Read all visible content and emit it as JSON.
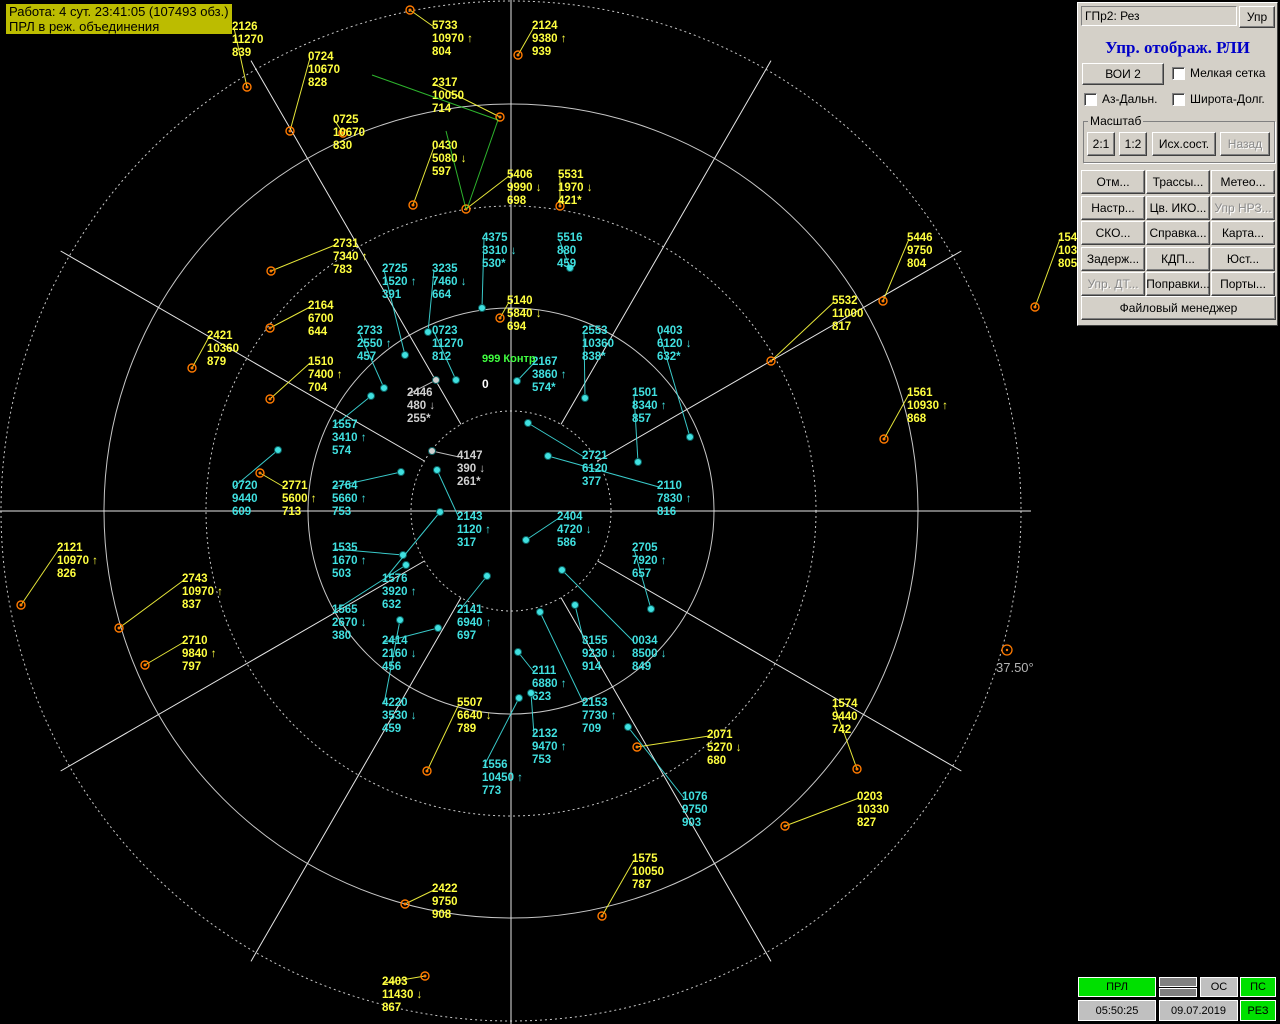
{
  "status": {
    "line1": "Работа: 4 сут. 23:41:05 (107493 обз.)",
    "line2": "ПРЛ в реж. объединения"
  },
  "radar": {
    "bearing_label": "37.50°",
    "center_marker": "0",
    "control_label": "999 Контр",
    "colors": {
      "ring": "#c8c8c8",
      "axis": "#e6e6e6",
      "yellow": "#ffff40",
      "cyan": "#40e0e0",
      "gray": "#d0d0d0",
      "green": "#40ff40",
      "marker": "#ff7a00"
    }
  },
  "tracks": [
    {
      "color": "yellow",
      "lines": [
        "2126",
        "11270",
        "839"
      ]
    },
    {
      "color": "yellow",
      "lines": [
        "0724",
        "10670",
        "828"
      ]
    },
    {
      "color": "yellow",
      "lines": [
        "0725",
        "10670",
        "830"
      ]
    },
    {
      "color": "yellow",
      "lines": [
        "5733",
        "10970 ↑",
        "804"
      ]
    },
    {
      "color": "yellow",
      "lines": [
        "2124",
        "9380 ↑",
        "939"
      ]
    },
    {
      "color": "yellow",
      "lines": [
        "2317",
        "10050",
        "714"
      ]
    },
    {
      "color": "yellow",
      "lines": [
        "0430",
        "5080 ↓",
        "597"
      ]
    },
    {
      "color": "yellow",
      "lines": [
        "5406",
        "9990 ↓",
        "698"
      ]
    },
    {
      "color": "yellow",
      "lines": [
        "5531",
        "1970 ↓",
        "421*"
      ]
    },
    {
      "color": "yellow",
      "lines": [
        "2731",
        "7340 ↑",
        "783"
      ]
    },
    {
      "color": "yellow",
      "lines": [
        "2164",
        "6700",
        "644"
      ]
    },
    {
      "color": "yellow",
      "lines": [
        "2421",
        "10360",
        "879"
      ]
    },
    {
      "color": "yellow",
      "lines": [
        "1510",
        "7400 ↑",
        "704"
      ]
    },
    {
      "color": "yellow",
      "lines": [
        "5140",
        "5840 ↓",
        "694"
      ]
    },
    {
      "color": "yellow",
      "lines": [
        "5446",
        "9750",
        "804"
      ]
    },
    {
      "color": "yellow",
      "lines": [
        "154",
        "103",
        "805"
      ]
    },
    {
      "color": "yellow",
      "lines": [
        "5532",
        "11000",
        "817"
      ]
    },
    {
      "color": "yellow",
      "lines": [
        "1561",
        "10930 ↑",
        "868"
      ]
    },
    {
      "color": "yellow",
      "lines": [
        "2771",
        "5600 ↑",
        "713"
      ]
    },
    {
      "color": "yellow",
      "lines": [
        "2121",
        "10970 ↑",
        "826"
      ]
    },
    {
      "color": "yellow",
      "lines": [
        "2743",
        "10970 ↑",
        "837"
      ]
    },
    {
      "color": "yellow",
      "lines": [
        "2710",
        "9840 ↑",
        "797"
      ]
    },
    {
      "color": "yellow",
      "lines": [
        "5507",
        "6640 ↓",
        "789"
      ]
    },
    {
      "color": "yellow",
      "lines": [
        "2071",
        "5270 ↓",
        "680"
      ]
    },
    {
      "color": "yellow",
      "lines": [
        "1574",
        "9440",
        "742"
      ]
    },
    {
      "color": "yellow",
      "lines": [
        "0203",
        "10330",
        "827"
      ]
    },
    {
      "color": "yellow",
      "lines": [
        "1575",
        "10050",
        "787"
      ]
    },
    {
      "color": "yellow",
      "lines": [
        "2422",
        "9750",
        "908"
      ]
    },
    {
      "color": "yellow",
      "lines": [
        "2403",
        "11430 ↓",
        "867"
      ]
    },
    {
      "color": "cyan",
      "lines": [
        "4375",
        "3310 ↓",
        "530*"
      ]
    },
    {
      "color": "cyan",
      "lines": [
        "5516",
        "880",
        "459"
      ]
    },
    {
      "color": "cyan",
      "lines": [
        "2725",
        "1520 ↑",
        "391"
      ]
    },
    {
      "color": "cyan",
      "lines": [
        "3235",
        "7460 ↓",
        "664"
      ]
    },
    {
      "color": "cyan",
      "lines": [
        "2733",
        "2550 ↑",
        "457"
      ]
    },
    {
      "color": "cyan",
      "lines": [
        "0723",
        "11270",
        "812"
      ]
    },
    {
      "color": "cyan",
      "lines": [
        "2553",
        "10360",
        "838*"
      ]
    },
    {
      "color": "cyan",
      "lines": [
        "0403",
        "6120 ↓",
        "632*"
      ]
    },
    {
      "color": "cyan",
      "lines": [
        "2167",
        "3860 ↑",
        "574*"
      ]
    },
    {
      "color": "cyan",
      "lines": [
        "1501",
        "8340 ↑",
        "857"
      ]
    },
    {
      "color": "cyan",
      "lines": [
        "1557",
        "3410 ↑",
        "574"
      ]
    },
    {
      "color": "cyan",
      "lines": [
        "2721",
        "6120",
        "377"
      ]
    },
    {
      "color": "cyan",
      "lines": [
        "2110",
        "7830 ↑",
        "816"
      ]
    },
    {
      "color": "cyan",
      "lines": [
        "0720",
        "9440",
        "609"
      ]
    },
    {
      "color": "cyan",
      "lines": [
        "2764",
        "5660 ↑",
        "753"
      ]
    },
    {
      "color": "cyan",
      "lines": [
        "2143",
        "1120 ↑",
        "317"
      ]
    },
    {
      "color": "cyan",
      "lines": [
        "2404",
        "4720 ↓",
        "586"
      ]
    },
    {
      "color": "cyan",
      "lines": [
        "1535",
        "1670 ↑",
        "503"
      ]
    },
    {
      "color": "cyan",
      "lines": [
        "2705",
        "7920 ↑",
        "657"
      ]
    },
    {
      "color": "cyan",
      "lines": [
        "1576",
        "3920 ↑",
        "632"
      ]
    },
    {
      "color": "cyan",
      "lines": [
        "1565",
        "2670 ↓",
        "380"
      ]
    },
    {
      "color": "cyan",
      "lines": [
        "2141",
        "6940 ↑",
        "697"
      ]
    },
    {
      "color": "cyan",
      "lines": [
        "2414",
        "2160 ↓",
        "456"
      ]
    },
    {
      "color": "cyan",
      "lines": [
        "3155",
        "9230 ↓",
        "914"
      ]
    },
    {
      "color": "cyan",
      "lines": [
        "0034",
        "8500 ↓",
        "849"
      ]
    },
    {
      "color": "cyan",
      "lines": [
        "2111",
        "6880 ↑",
        "623"
      ]
    },
    {
      "color": "cyan",
      "lines": [
        "4220",
        "3530 ↓",
        "459"
      ]
    },
    {
      "color": "cyan",
      "lines": [
        "2153",
        "7730 ↑",
        "709"
      ]
    },
    {
      "color": "cyan",
      "lines": [
        "2132",
        "9470 ↑",
        "753"
      ]
    },
    {
      "color": "cyan",
      "lines": [
        "1556",
        "10450 ↑",
        "773"
      ]
    },
    {
      "color": "cyan",
      "lines": [
        "1076",
        "9750",
        "903"
      ]
    },
    {
      "color": "gray",
      "lines": [
        "2446",
        "480 ↓",
        "255*"
      ]
    },
    {
      "color": "gray",
      "lines": [
        "4147",
        "390 ↓",
        "261*"
      ]
    }
  ],
  "panel": {
    "mode_field": "ГПр2: Рез",
    "mode_button": "Упр",
    "title": "Упр. отображ. РЛИ",
    "voi_button": "ВОИ 2",
    "check_fine_grid": "Мелкая сетка",
    "check_az_range": "Аз-Дальн.",
    "check_lat_lon": "Широта-Долг.",
    "scale_group": "Масштаб",
    "scale_buttons": [
      "2:1",
      "1:2",
      "Исх.сост.",
      "Назад"
    ],
    "grid_buttons": [
      {
        "label": "Отм...",
        "enabled": true
      },
      {
        "label": "Трассы...",
        "enabled": true
      },
      {
        "label": "Метео...",
        "enabled": true
      },
      {
        "label": "Настр...",
        "enabled": true
      },
      {
        "label": "Цв. ИКО...",
        "enabled": true
      },
      {
        "label": "Упр НРЗ...",
        "enabled": false
      },
      {
        "label": "СКО...",
        "enabled": true
      },
      {
        "label": "Справка...",
        "enabled": true
      },
      {
        "label": "Карта...",
        "enabled": true
      },
      {
        "label": "Задерж...",
        "enabled": true
      },
      {
        "label": "КДП...",
        "enabled": true
      },
      {
        "label": "Юст...",
        "enabled": true
      },
      {
        "label": "Упр. ДТ...",
        "enabled": false
      },
      {
        "label": "Поправки...",
        "enabled": true
      },
      {
        "label": "Порты...",
        "enabled": true
      }
    ],
    "file_manager": "Файловый менеджер"
  },
  "bottom": {
    "prl": "ПРЛ",
    "os": "ОС",
    "ps": "ПС",
    "time": "05:50:25",
    "date": "09.07.2019",
    "rez": "РЕЗ"
  }
}
